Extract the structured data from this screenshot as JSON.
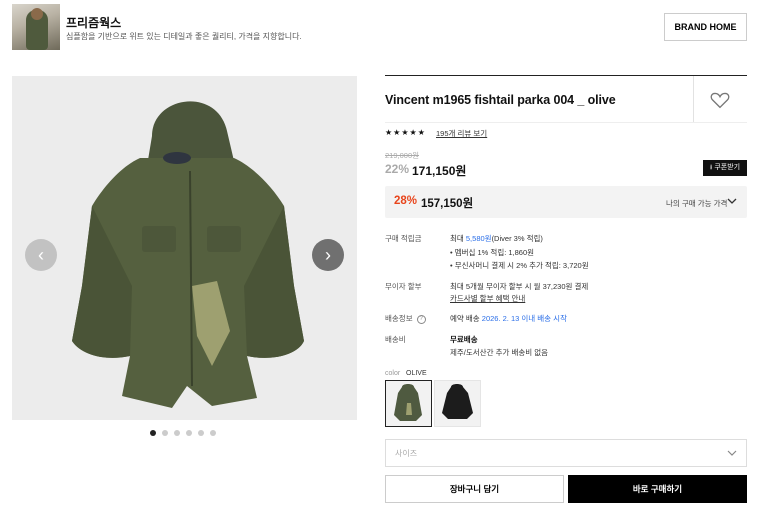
{
  "brand": {
    "name": "프리즘웍스",
    "description": "심플함을 기반으로 위트 있는 디테일과 좋은 퀄리티, 가격을 지향합니다.",
    "home_button": "BRAND HOME"
  },
  "gallery": {
    "image_count": 6,
    "active_index": 0,
    "prev_icon": "‹",
    "next_icon": "›"
  },
  "product": {
    "title": "Vincent m1965 fishtail parka 004 _ olive",
    "rating_stars": "★★★★★",
    "review_link": "195개 리뷰 보기",
    "original_price": "219,000원",
    "discount_rate": "22%",
    "sale_price": "171,150원",
    "coupon_button": "⭳ 쿠폰받기",
    "my_price": {
      "rate": "28%",
      "amount": "157,150원",
      "label": "나의 구매 가능 가격"
    }
  },
  "info": {
    "points": {
      "label": "구매 적립금",
      "max_prefix": "최대 ",
      "max_amount": "5,580원",
      "max_suffix": "(Diver 3% 적립)",
      "line1": "• 멤버십 1% 적립: 1,860원",
      "line2": "• 무신사머니 결제 시 2% 추가 적립: 3,720원"
    },
    "installment": {
      "label": "무이자 할부",
      "text": "최대 5개월 무이자 할부 시 월 37,230원 결제",
      "link": "카드사별 할부 혜택 안내"
    },
    "delivery": {
      "label": "배송정보",
      "prefix": "예약 배송 ",
      "date": "2026. 2. 13 이내 배송 시작"
    },
    "shipping": {
      "label": "배송비",
      "free": "무료배송",
      "note": "제주/도서산간 추가 배송비 없음"
    }
  },
  "options": {
    "color_label": "color",
    "color_value": "OLIVE",
    "size_placeholder": "사이즈"
  },
  "actions": {
    "cart": "장바구니 담기",
    "buy": "바로 구매하기"
  },
  "colors": {
    "accent_red": "#e8451c",
    "link_blue": "#2a6ee8",
    "parka_olive": "#4f5a40",
    "parka_black": "#1c1c1c"
  }
}
